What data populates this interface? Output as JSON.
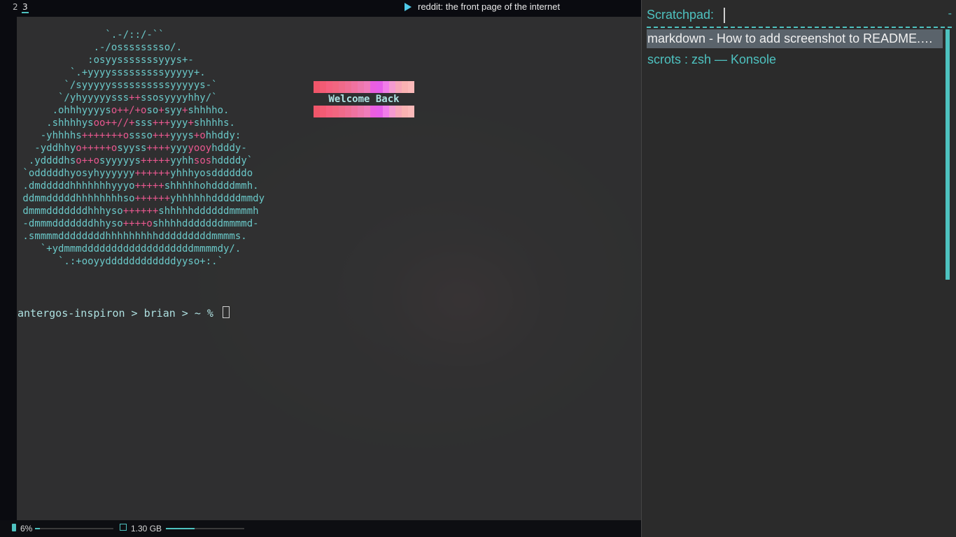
{
  "topbar": {
    "workspaces": [
      "2",
      "3"
    ],
    "active_workspace": "3",
    "window_title": "reddit: the front page of the internet",
    "play_icon": "play-icon"
  },
  "terminal": {
    "ascii_lines": [
      [
        [
          "               `.-/::/-``",
          "c"
        ]
      ],
      [
        [
          "             .-/osssssssso/.",
          "c"
        ]
      ],
      [
        [
          "            :osyysssssssyyys+-",
          "c"
        ]
      ],
      [
        [
          "         `.+yyyysssssssssyyyyy+.",
          "c"
        ]
      ],
      [
        [
          "        `/syyyyyssssssssssyyyyys-`",
          "c"
        ]
      ],
      [
        [
          "       `/yhyyyyysss",
          "c"
        ],
        [
          "++",
          "p"
        ],
        [
          "ssosyyyyhhy/`",
          "c"
        ]
      ],
      [
        [
          "      .ohhhyyyys",
          "c"
        ],
        [
          "o++/+o",
          "p"
        ],
        [
          "so",
          "c"
        ],
        [
          "+",
          "p"
        ],
        [
          "syy",
          "c"
        ],
        [
          "+",
          "p"
        ],
        [
          "shhhho.",
          "c"
        ]
      ],
      [
        [
          "     .shhhhys",
          "c"
        ],
        [
          "oo++//+",
          "p"
        ],
        [
          "sss",
          "c"
        ],
        [
          "+++",
          "p"
        ],
        [
          "yyy",
          "c"
        ],
        [
          "+",
          "p"
        ],
        [
          "shhhhs.",
          "c"
        ]
      ],
      [
        [
          "    -yhhhhs",
          "c"
        ],
        [
          "+++++++o",
          "p"
        ],
        [
          "ssso",
          "c"
        ],
        [
          "+++",
          "p"
        ],
        [
          "yyys",
          "c"
        ],
        [
          "+o",
          "p"
        ],
        [
          "hhddy:",
          "c"
        ]
      ],
      [
        [
          "   -yddhhy",
          "c"
        ],
        [
          "o+++++o",
          "p"
        ],
        [
          "syyss",
          "c"
        ],
        [
          "++++",
          "p"
        ],
        [
          "yyy",
          "c"
        ],
        [
          "yooy",
          "p"
        ],
        [
          "hdddy-",
          "c"
        ]
      ],
      [
        [
          "  .yddddhs",
          "c"
        ],
        [
          "o++o",
          "p"
        ],
        [
          "syyyyys",
          "c"
        ],
        [
          "+++++",
          "p"
        ],
        [
          "yyhh",
          "c"
        ],
        [
          "sos",
          "p"
        ],
        [
          "hddddy`",
          "c"
        ]
      ],
      [
        [
          " `odddddhyosyhyyyyyy",
          "c"
        ],
        [
          "++++++",
          "p"
        ],
        [
          "yhhhyosddddddo",
          "c"
        ]
      ],
      [
        [
          " .dmdddddhhhhhhhyyyo",
          "c"
        ],
        [
          "+++++",
          "p"
        ],
        [
          "shhhhhohddddmmh.",
          "c"
        ]
      ],
      [
        [
          " ddmmdddddhhhhhhhhso",
          "c"
        ],
        [
          "++++++",
          "p"
        ],
        [
          "yhhhhhhdddddmmdy",
          "c"
        ]
      ],
      [
        [
          " dmmmdddddddhhhyso",
          "c"
        ],
        [
          "++++++",
          "p"
        ],
        [
          "shhhhhddddddmmmmh",
          "c"
        ]
      ],
      [
        [
          " -dmmmdddddddhhyso",
          "c"
        ],
        [
          "++++o",
          "p"
        ],
        [
          "shhhhdddddddmmmmd-",
          "c"
        ]
      ],
      [
        [
          " .smmmmddddddddhhhhhhhhhdddddddddmmmms.",
          "c"
        ]
      ],
      [
        [
          "    `+ydmmmdddddddddddddddddddmmmmdy/.",
          "c"
        ]
      ],
      [
        [
          "       `.:+ooyyddddddddddddyyso+:.`",
          "c"
        ]
      ]
    ],
    "welcome": {
      "text": "Welcome Back",
      "bar_colors": [
        "#f0566a",
        "#f35b74",
        "#f5607e",
        "#f26680",
        "#f06a8a",
        "#ef6e94",
        "#f072a0",
        "#ee78ad",
        "#f07cba",
        "#ea5ee0",
        "#e65ee8",
        "#f17de8",
        "#f59ad0",
        "#f7a6b8",
        "#f9b2b2",
        "#fbb9b9"
      ]
    },
    "prompt": "antergos-inspiron > brian > ~ % "
  },
  "bottombar": {
    "cpu_label": "6%",
    "cpu_fraction": 0.06,
    "mem_label": "1.30 GB",
    "mem_fraction": 0.37,
    "cpu_icon": "cpu-icon",
    "mem_icon": "memory-icon"
  },
  "scratchpad": {
    "label": "Scratchpad:",
    "dash": "-",
    "items": [
      "markdown - How to add screenshot to README.md on github? - Stack Overflow",
      "scrots : zsh — Konsole"
    ],
    "selected_index": 0
  },
  "colors": {
    "accent": "#4ec2c0",
    "ascii_highlight": "#e8588f",
    "terminal_bg": "#343434",
    "panel_bg": "#2b2b2b",
    "selection_bg": "#5a636b"
  }
}
